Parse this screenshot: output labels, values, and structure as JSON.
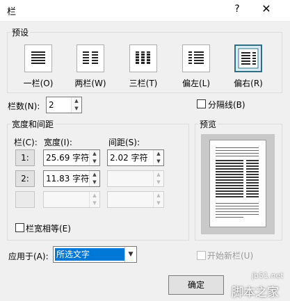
{
  "dialog": {
    "title": "栏",
    "help_glyph": "?",
    "close_glyph": "✕"
  },
  "presets": {
    "group_title": "预设",
    "items": [
      {
        "label": "一栏(O)",
        "icon": "one-column-icon"
      },
      {
        "label": "两栏(W)",
        "icon": "two-columns-icon"
      },
      {
        "label": "三栏(T)",
        "icon": "three-columns-icon"
      },
      {
        "label": "偏左(L)",
        "icon": "left-column-icon"
      },
      {
        "label": "偏右(R)",
        "icon": "right-column-icon"
      }
    ],
    "selected": "偏右(R)"
  },
  "num_columns": {
    "label": "栏数(N):",
    "value": "2"
  },
  "line_between": {
    "label": "分隔线(B)",
    "checked": false
  },
  "width_spacing": {
    "group_title": "宽度和间距",
    "col_header": "栏(C):",
    "width_header": "宽度(I):",
    "spacing_header": "间距(S):",
    "rows": [
      {
        "num": "1:",
        "width": "25.69 字符",
        "spacing": "2.02 字符"
      },
      {
        "num": "2:",
        "width": "11.83 字符",
        "spacing": ""
      },
      {
        "num": "",
        "width": "",
        "spacing": ""
      }
    ],
    "equal_width": {
      "label": "栏宽相等(E)",
      "checked": false
    }
  },
  "preview": {
    "group_title": "预览"
  },
  "apply_to": {
    "label": "应用于(A):",
    "value": "所选文字"
  },
  "start_new_column": {
    "label": "开始新栏(U)",
    "checked": false
  },
  "ok_button": {
    "label": "确定"
  },
  "watermark": {
    "line1": "jb51.net",
    "line2": "脚本之家"
  },
  "colors": {
    "accent": "#0078d7",
    "selected_border": "#2f6f86",
    "dialog_bg": "#f0f0f0"
  }
}
